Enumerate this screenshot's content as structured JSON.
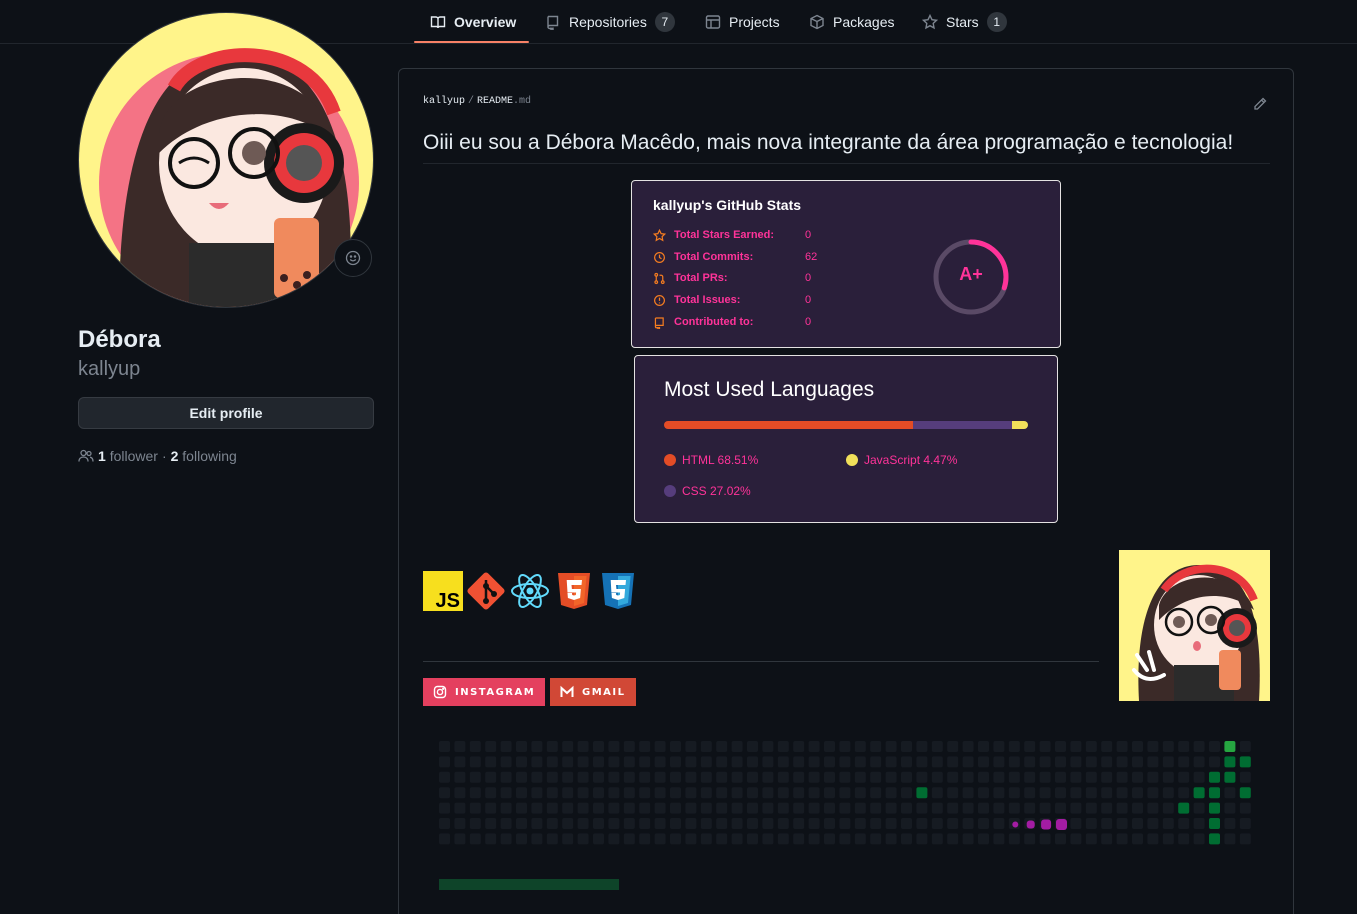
{
  "nav": {
    "tabs": [
      {
        "label": "Overview",
        "icon": "book-icon",
        "active": true
      },
      {
        "label": "Repositories",
        "icon": "repo-icon",
        "count": "7"
      },
      {
        "label": "Projects",
        "icon": "table-icon"
      },
      {
        "label": "Packages",
        "icon": "package-icon"
      },
      {
        "label": "Stars",
        "icon": "star-icon",
        "count": "1"
      }
    ]
  },
  "profile": {
    "name": "Débora",
    "login": "kallyup",
    "edit_button": "Edit profile",
    "followers_count": "1",
    "followers_label": "follower",
    "separator": "·",
    "following_count": "2",
    "following_label": "following"
  },
  "readme": {
    "owner": "kallyup",
    "separator": "/",
    "filename": "README",
    "extension": ".md",
    "heading": "Oiii eu sou a Débora Macêdo, mais nova integrante da área programação e tecnologia!"
  },
  "stats_card": {
    "title": "kallyup's GitHub Stats",
    "rows": [
      {
        "label": "Total Stars Earned:",
        "value": "0",
        "icon": "star-icon"
      },
      {
        "label": "Total Commits:",
        "value": "62",
        "icon": "history-icon"
      },
      {
        "label": "Total PRs:",
        "value": "0",
        "icon": "pull-request-icon"
      },
      {
        "label": "Total Issues:",
        "value": "0",
        "icon": "issue-icon"
      },
      {
        "label": "Contributed to:",
        "value": "0",
        "icon": "repo-icon"
      }
    ],
    "rank": "A+",
    "rank_progress": 0.3,
    "accent": "#ff3399",
    "icon_color": "#f47c20",
    "bg": "#2a1f3a"
  },
  "langs_card": {
    "title": "Most Used Languages",
    "languages": [
      {
        "label": "HTML 68.51%",
        "percent": 68.51,
        "color": "#e34c26"
      },
      {
        "label": "CSS 27.02%",
        "percent": 27.02,
        "color": "#563d7c"
      },
      {
        "label": "JavaScript 4.47%",
        "percent": 4.47,
        "color": "#f1e05a"
      }
    ]
  },
  "tech_icons": [
    "javascript-icon",
    "git-icon",
    "react-icon",
    "html5-icon",
    "css3-icon"
  ],
  "badges": [
    {
      "label": "INSTAGRAM",
      "icon": "instagram-icon",
      "color": "#e4405f"
    },
    {
      "label": "GMAIL",
      "icon": "gmail-icon",
      "color": "#d14836"
    }
  ]
}
